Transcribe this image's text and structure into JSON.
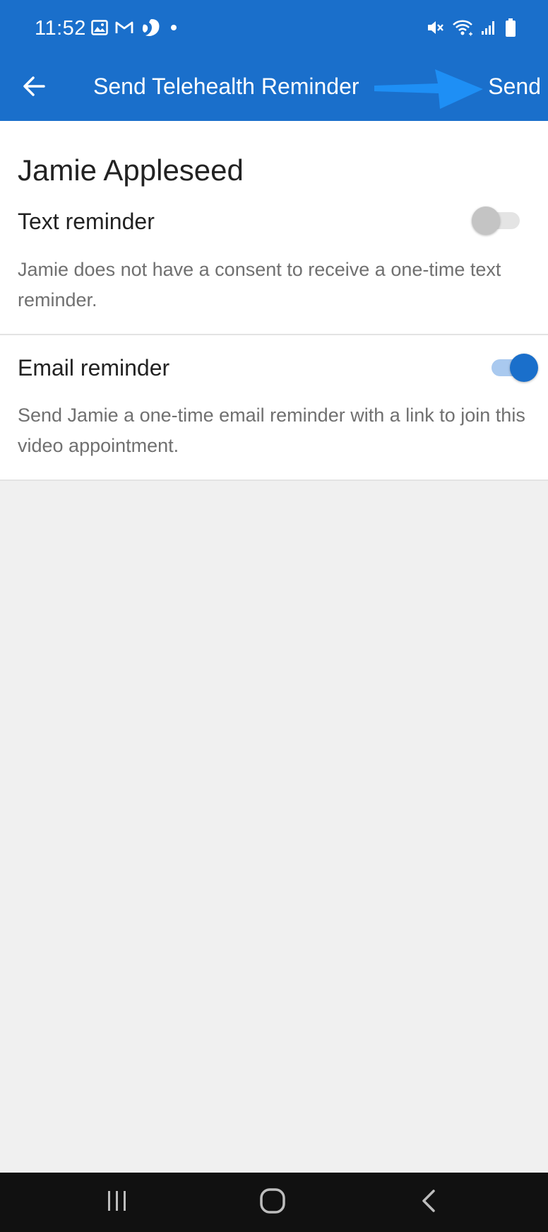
{
  "status_bar": {
    "time": "11:52",
    "left_icons": [
      "gallery-icon",
      "gmail-icon",
      "phone-app-icon",
      "dot-icon"
    ],
    "right_icons": [
      "mute-icon",
      "wifi-icon",
      "signal-icon",
      "battery-icon"
    ]
  },
  "app_bar": {
    "back_icon": "arrow-left-icon",
    "title": "Send Telehealth Reminder",
    "send_label": "Send",
    "annotation": "arrow-pointing-right"
  },
  "patient": {
    "name": "Jamie Appleseed"
  },
  "text_reminder": {
    "label": "Text reminder",
    "enabled": false,
    "description": "Jamie does not have a consent to receive a one-time text reminder."
  },
  "email_reminder": {
    "label": "Email reminder",
    "enabled": true,
    "description": "Send Jamie a one-time email reminder with a link to join this video appointment."
  },
  "nav_bar": {
    "icons": [
      "recents-icon",
      "home-icon",
      "back-icon"
    ]
  },
  "colors": {
    "primary": "#1a6fcb",
    "annotation_arrow": "#1e8ff5",
    "background": "#f0f0f0",
    "navbar": "#111111"
  }
}
